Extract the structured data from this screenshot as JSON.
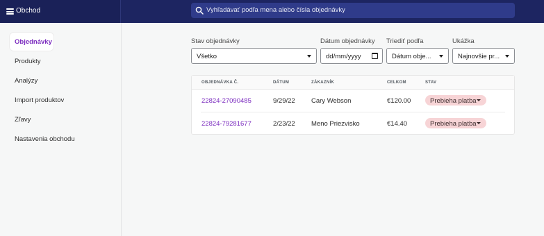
{
  "topbar": {
    "store_title": "Obchod",
    "search_placeholder": "Vyhľadávať podľa mena alebo čísla objednávky"
  },
  "sidebar": {
    "items": [
      {
        "label": "Objednávky",
        "active": true
      },
      {
        "label": "Produkty"
      },
      {
        "label": "Analýzy"
      },
      {
        "label": "Import produktov"
      },
      {
        "label": "Zľavy"
      },
      {
        "label": "Nastavenia obchodu"
      }
    ]
  },
  "filters": {
    "status": {
      "label": "Stav objednávky",
      "value": "Všetko"
    },
    "date": {
      "label": "Dátum objednávky",
      "value": "dd/mm/yyyy"
    },
    "sort": {
      "label": "Triediť podľa",
      "value": "Dátum obje..."
    },
    "preview": {
      "label": "Ukážka",
      "value": "Najnovšie pr..."
    }
  },
  "orders_table": {
    "columns": [
      "OBJEDNÁVKA Č.",
      "DÁTUM",
      "ZÁKAZNÍK",
      "CELKOM",
      "STAV"
    ],
    "rows": [
      {
        "order_no": "22824-27090485",
        "date": "9/29/22",
        "customer": "Cary Webson",
        "total": "€120.00",
        "status": "Prebieha platba"
      },
      {
        "order_no": "22824-79281677",
        "date": "2/23/22",
        "customer": "Meno Priezvisko",
        "total": "€14.40",
        "status": "Prebieha platba"
      }
    ]
  },
  "colors": {
    "topbar": "#1d2561",
    "accent": "#7b2cbf",
    "status_badge": "#f7d4d6"
  }
}
